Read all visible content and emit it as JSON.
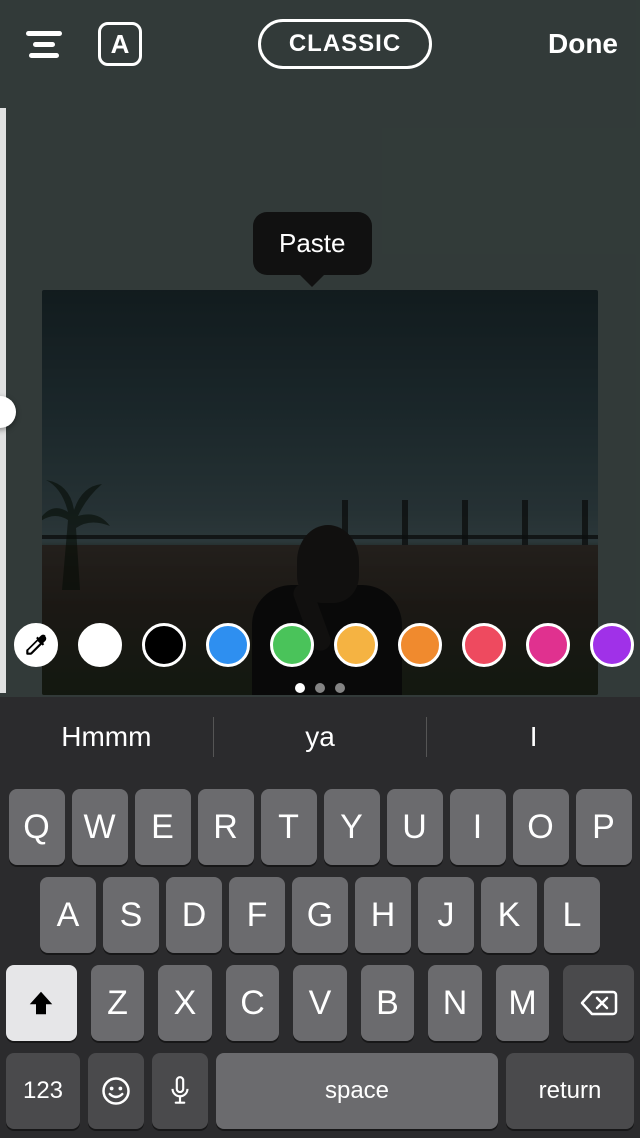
{
  "header": {
    "font_letter": "A",
    "style_label": "CLASSIC",
    "done_label": "Done"
  },
  "context_menu": {
    "paste_label": "Paste"
  },
  "color_palette": {
    "eyedropper_icon": "eyedropper-icon",
    "colors": [
      "#ffffff",
      "#000000",
      "#2e8ff0",
      "#4ac35a",
      "#f5b342",
      "#f08a2e",
      "#ee4a5f",
      "#e0318f",
      "#a031e8"
    ],
    "page_index": 0,
    "page_count": 3
  },
  "keyboard": {
    "suggestions": [
      "Hmmm",
      "ya",
      "I"
    ],
    "row1": [
      "Q",
      "W",
      "E",
      "R",
      "T",
      "Y",
      "U",
      "I",
      "O",
      "P"
    ],
    "row2": [
      "A",
      "S",
      "D",
      "F",
      "G",
      "H",
      "J",
      "K",
      "L"
    ],
    "row3": [
      "Z",
      "X",
      "C",
      "V",
      "B",
      "N",
      "M"
    ],
    "numbers_label": "123",
    "space_label": "space",
    "return_label": "return",
    "shift_active": true
  }
}
